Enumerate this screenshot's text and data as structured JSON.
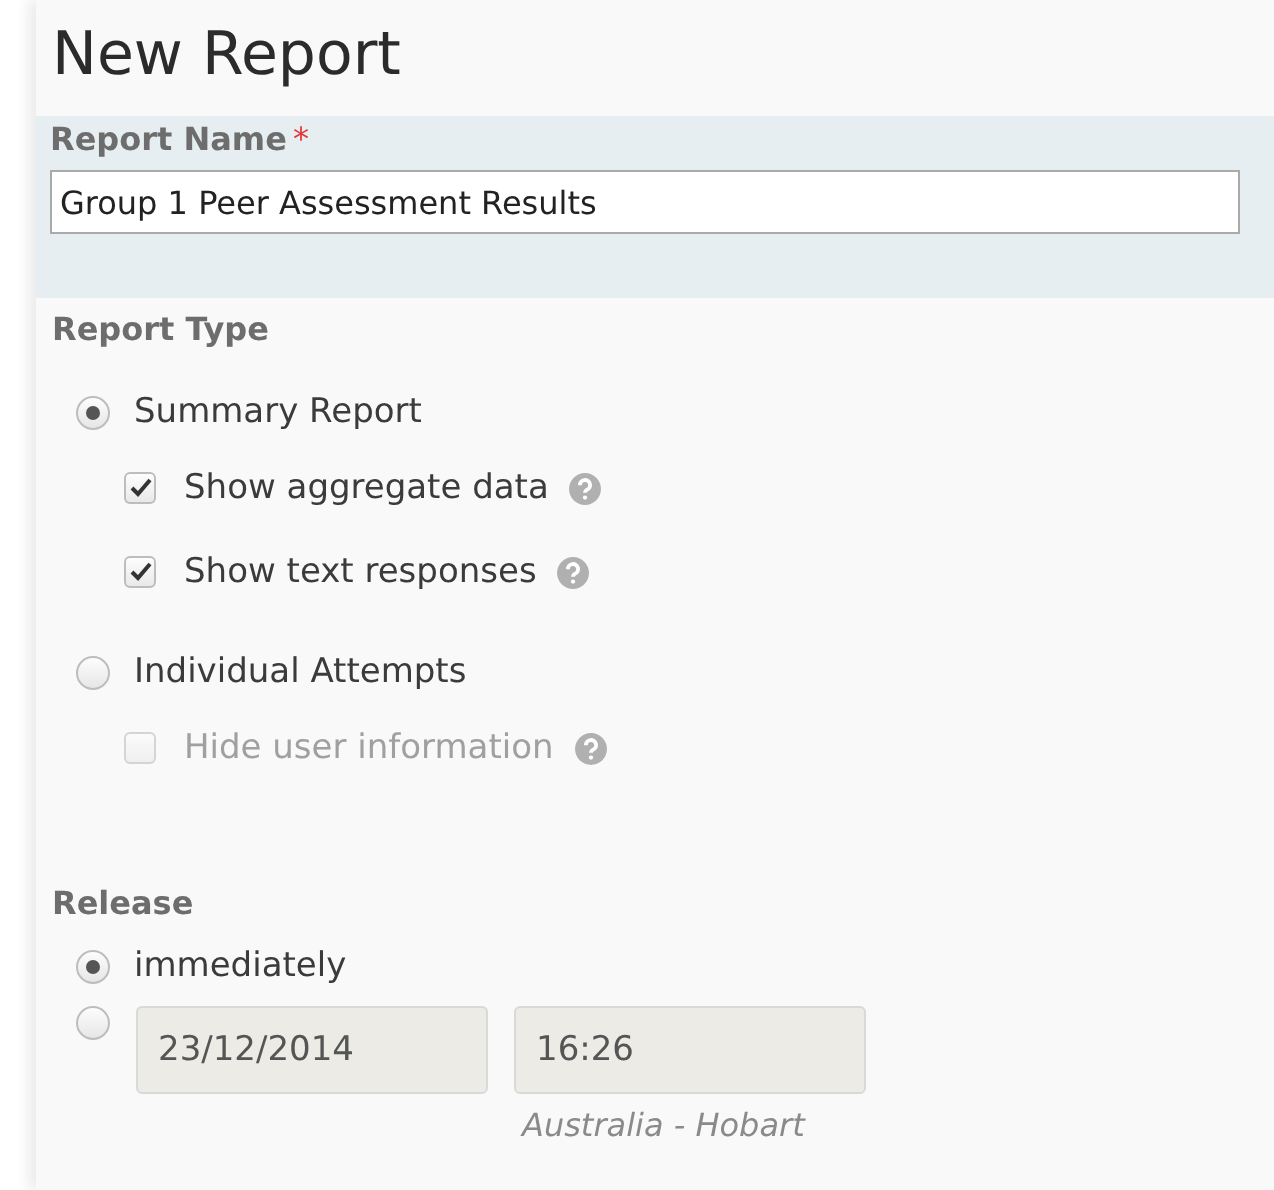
{
  "title": "New Report",
  "report_name": {
    "label": "Report Name",
    "required_mark": "*",
    "value": "Group 1 Peer Assessment Results"
  },
  "report_type": {
    "label": "Report Type",
    "options": [
      {
        "label": "Summary Report",
        "selected": true,
        "suboptions": [
          {
            "label": "Show aggregate data",
            "checked": true,
            "disabled": false
          },
          {
            "label": "Show text responses",
            "checked": true,
            "disabled": false
          }
        ]
      },
      {
        "label": "Individual Attempts",
        "selected": false,
        "suboptions": [
          {
            "label": "Hide user information",
            "checked": false,
            "disabled": true
          }
        ]
      }
    ]
  },
  "release": {
    "label": "Release",
    "options": [
      {
        "kind": "text",
        "label": "immediately",
        "selected": true
      },
      {
        "kind": "datetime",
        "selected": false,
        "date": "23/12/2014",
        "time": "16:26",
        "timezone": "Australia - Hobart"
      }
    ]
  }
}
